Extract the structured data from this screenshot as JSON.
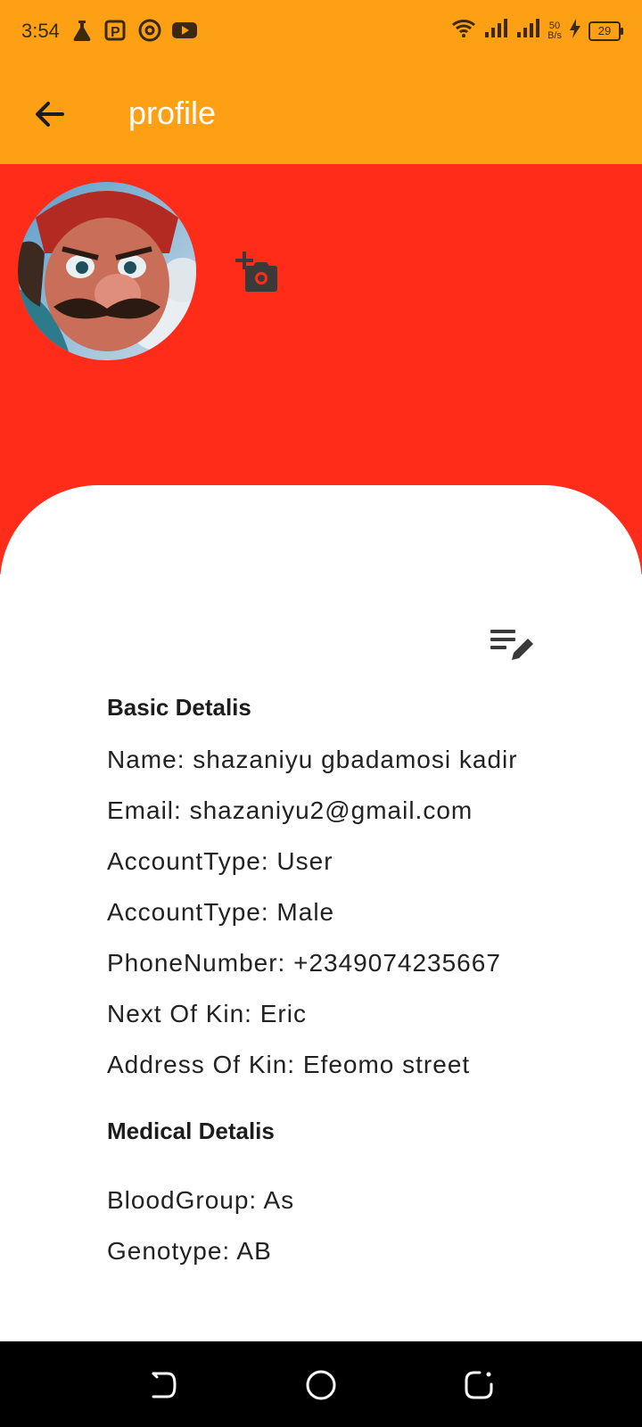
{
  "status_bar": {
    "time": "3:54",
    "speed_value": "50",
    "speed_unit": "B/s",
    "battery": "29"
  },
  "app_bar": {
    "title": "profile",
    "back_icon": "arrow-back-icon"
  },
  "profile": {
    "avatar_icon": "avatar-image",
    "add_photo_icon": "add-photo-camera-icon",
    "edit_icon": "edit-note-icon"
  },
  "basic": {
    "title": "Basic Detalis",
    "name": "Name: shazaniyu gbadamosi kadir",
    "email": "Email: shazaniyu2@gmail.com",
    "account_type": "AccountType: User",
    "gender": "AccountType: Male",
    "phone": "PhoneNumber: +2349074235667",
    "kin": "Next Of Kin: Eric",
    "kin_address": "Address Of Kin: Efeomo street"
  },
  "medical": {
    "title": "Medical Detalis",
    "blood_group": "BloodGroup: As",
    "genotype": "Genotype: AB"
  },
  "colors": {
    "status_bar": "#FDA014",
    "header": "#FF2C1A",
    "card": "#FFFFFF"
  }
}
